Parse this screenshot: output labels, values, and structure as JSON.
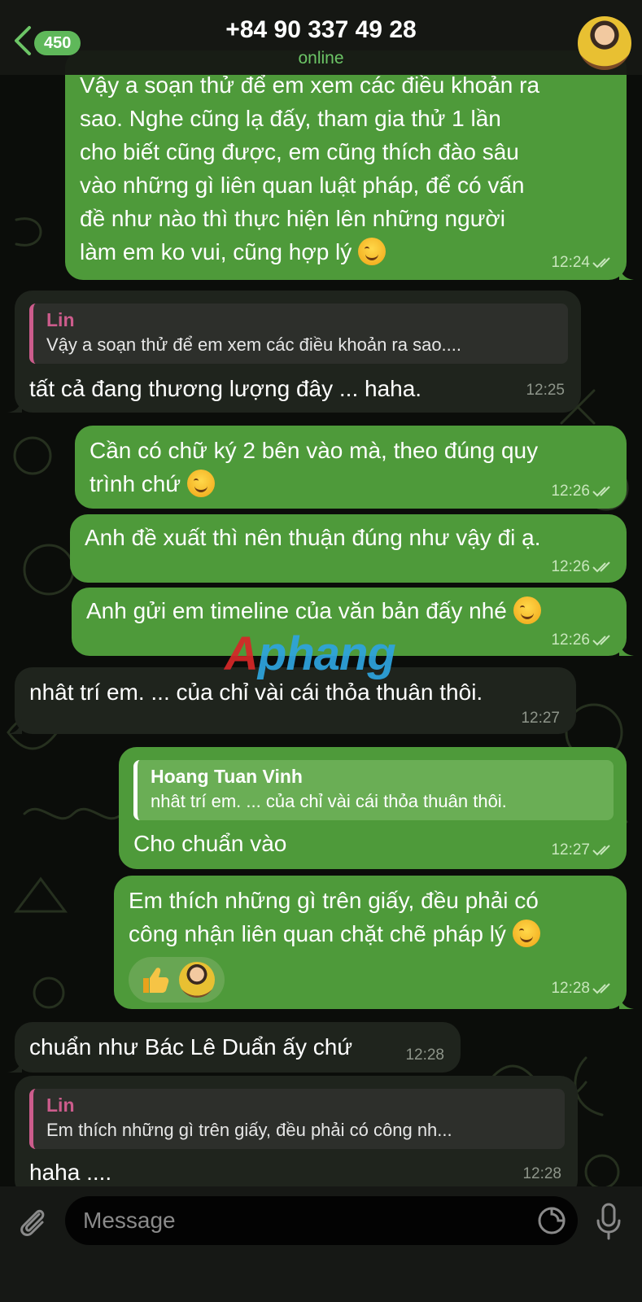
{
  "header": {
    "back_label": "450",
    "title": "+84 90 337 49 28",
    "status": "online"
  },
  "messages": [
    {
      "id": "m1",
      "direction": "outgoing",
      "lines": [
        "Vậy a soạn thử để em xem các điều khoản ra",
        "sao. Nghe cũng lạ đấy, tham gia thử 1 lần",
        "cho biết cũng được, em cũng thích đào sâu",
        "vào những gì liên quan luật pháp, để có vấn",
        "đề như nào thì thực hiện lên những người",
        "làm em ko vui, cũng hợp lý"
      ],
      "has_emoji": true,
      "time": "12:24",
      "read": true
    },
    {
      "id": "m2",
      "direction": "incoming",
      "reply": {
        "name": "Lin",
        "text": "Vậy a soạn thử để em xem các điều khoản ra sao...."
      },
      "lines": [
        "tất cả đang thương lượng đây ... haha."
      ],
      "time": "12:25"
    },
    {
      "id": "m3",
      "direction": "outgoing",
      "lines": [
        "Cần có chữ ký 2 bên vào mà, theo đúng quy",
        "trình chứ"
      ],
      "has_emoji": true,
      "time": "12:26",
      "read": true
    },
    {
      "id": "m4",
      "direction": "outgoing",
      "lines": [
        "Anh đề xuất thì nên thuận đúng như vậy đi ạ."
      ],
      "time": "12:26",
      "read": true
    },
    {
      "id": "m5",
      "direction": "outgoing",
      "lines": [
        "Anh gửi em timeline của văn bản đấy nhé"
      ],
      "has_emoji": true,
      "time": "12:26",
      "read": true
    },
    {
      "id": "m6",
      "direction": "incoming",
      "lines": [
        "nhât trí em. ... của chỉ vài cái thỏa thuân thôi."
      ],
      "time": "12:27"
    },
    {
      "id": "m7",
      "direction": "outgoing",
      "reply": {
        "name": "Hoang Tuan Vinh",
        "text": "nhât trí em. ... của chỉ vài cái thỏa thuân thôi."
      },
      "lines": [
        "Cho chuẩn vào"
      ],
      "time": "12:27",
      "read": true
    },
    {
      "id": "m8",
      "direction": "outgoing",
      "lines": [
        "Em thích những gì trên giấy, đều phải có",
        "công nhận liên quan chặt chẽ pháp lý"
      ],
      "has_emoji": true,
      "reaction": "thumbs-up",
      "time": "12:28",
      "read": true
    },
    {
      "id": "m9",
      "direction": "incoming",
      "lines": [
        "chuẩn như Bác Lê Duẩn ấy chứ"
      ],
      "time": "12:28"
    },
    {
      "id": "m10",
      "direction": "incoming",
      "reply": {
        "name": "Lin",
        "text": "Em thích những gì trên giấy, đều phải có công nh..."
      },
      "lines": [
        "haha ...."
      ],
      "time": "12:28"
    }
  ],
  "watermark": {
    "first": "A",
    "rest": "phang"
  },
  "composer": {
    "placeholder": "Message"
  },
  "colors": {
    "outgoing_bubble": "#4e9a3a",
    "incoming_bubble": "#1f241d",
    "online_green": "#6cc566",
    "reply_name_pink": "#cc5c8c"
  },
  "icons": [
    "back-chevron-icon",
    "avatar",
    "double-check-icon",
    "attach-paperclip-icon",
    "sticker-icon",
    "microphone-icon",
    "smile-emoji-icon",
    "thumbs-up-icon"
  ]
}
